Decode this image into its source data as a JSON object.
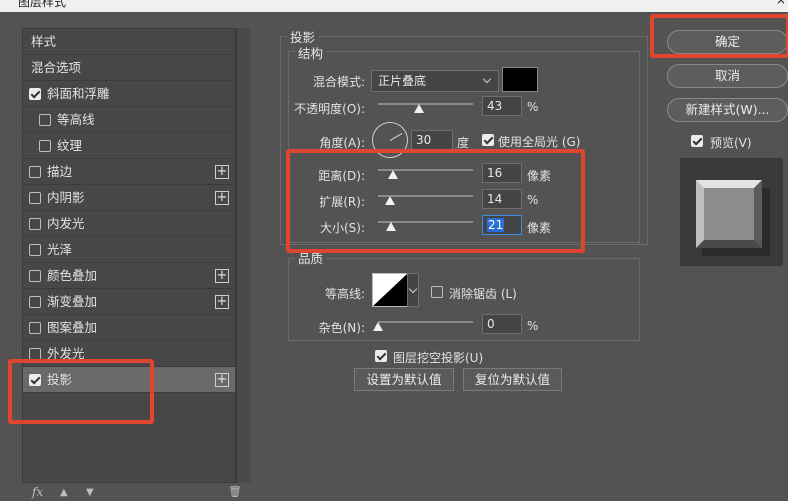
{
  "window": {
    "title": "图层样式",
    "close_label": "×"
  },
  "sidebar": {
    "items": [
      {
        "label": "样式",
        "checkbox": false,
        "checked": false,
        "plus": false,
        "indent": false
      },
      {
        "label": "混合选项",
        "checkbox": false,
        "checked": false,
        "plus": false,
        "indent": false
      },
      {
        "label": "斜面和浮雕",
        "checkbox": true,
        "checked": true,
        "plus": false,
        "indent": false
      },
      {
        "label": "等高线",
        "checkbox": true,
        "checked": false,
        "plus": false,
        "indent": true
      },
      {
        "label": "纹理",
        "checkbox": true,
        "checked": false,
        "plus": false,
        "indent": true
      },
      {
        "label": "描边",
        "checkbox": true,
        "checked": false,
        "plus": true,
        "indent": false
      },
      {
        "label": "内阴影",
        "checkbox": true,
        "checked": false,
        "plus": true,
        "indent": false
      },
      {
        "label": "内发光",
        "checkbox": true,
        "checked": false,
        "plus": false,
        "indent": false
      },
      {
        "label": "光泽",
        "checkbox": true,
        "checked": false,
        "plus": false,
        "indent": false
      },
      {
        "label": "颜色叠加",
        "checkbox": true,
        "checked": false,
        "plus": true,
        "indent": false
      },
      {
        "label": "渐变叠加",
        "checkbox": true,
        "checked": false,
        "plus": true,
        "indent": false
      },
      {
        "label": "图案叠加",
        "checkbox": true,
        "checked": false,
        "plus": false,
        "indent": false
      },
      {
        "label": "外发光",
        "checkbox": true,
        "checked": false,
        "plus": false,
        "indent": false
      },
      {
        "label": "投影",
        "checkbox": true,
        "checked": true,
        "plus": true,
        "indent": false,
        "selected": true
      }
    ],
    "plus_label": "+",
    "footer": {
      "fx": "fx",
      "up": "▲",
      "down": "▼",
      "trash": "🗑"
    }
  },
  "panel": {
    "section_title": "投影",
    "structure": {
      "title": "结构",
      "blend_mode_label": "混合模式:",
      "blend_mode_value": "正片叠底",
      "shadow_color": "#000000",
      "opacity_label": "不透明度(O):",
      "opacity_value": "43",
      "opacity_unit": "%",
      "opacity_level": 0.43,
      "angle_label": "角度(A):",
      "angle_value": "30",
      "angle_unit": "度",
      "global_light_label": "使用全局光 (G)",
      "global_light_checked": true,
      "distance_label": "距离(D):",
      "distance_value": "16",
      "distance_unit": "像素",
      "spread_label": "扩展(R):",
      "spread_value": "14",
      "spread_unit": "%",
      "size_label": "大小(S):",
      "size_value": "21",
      "size_unit": "像素"
    },
    "quality": {
      "title": "品质",
      "contour_label": "等高线:",
      "antialias_label": "消除锯齿 (L)",
      "noise_label": "杂色(N):",
      "noise_value": "0",
      "noise_unit": "%"
    },
    "knockout_label": "图层挖空投影(U)",
    "make_default_label": "设置为默认值",
    "reset_default_label": "复位为默认值"
  },
  "actions": {
    "ok_label": "确定",
    "cancel_label": "取消",
    "new_style_label": "新建样式(W)...",
    "preview_label": "预览(V)",
    "preview_checked": true
  },
  "colors": {
    "highlight": "#e0452f",
    "selection": "#2a6fd6",
    "dialog_bg": "#535353"
  }
}
